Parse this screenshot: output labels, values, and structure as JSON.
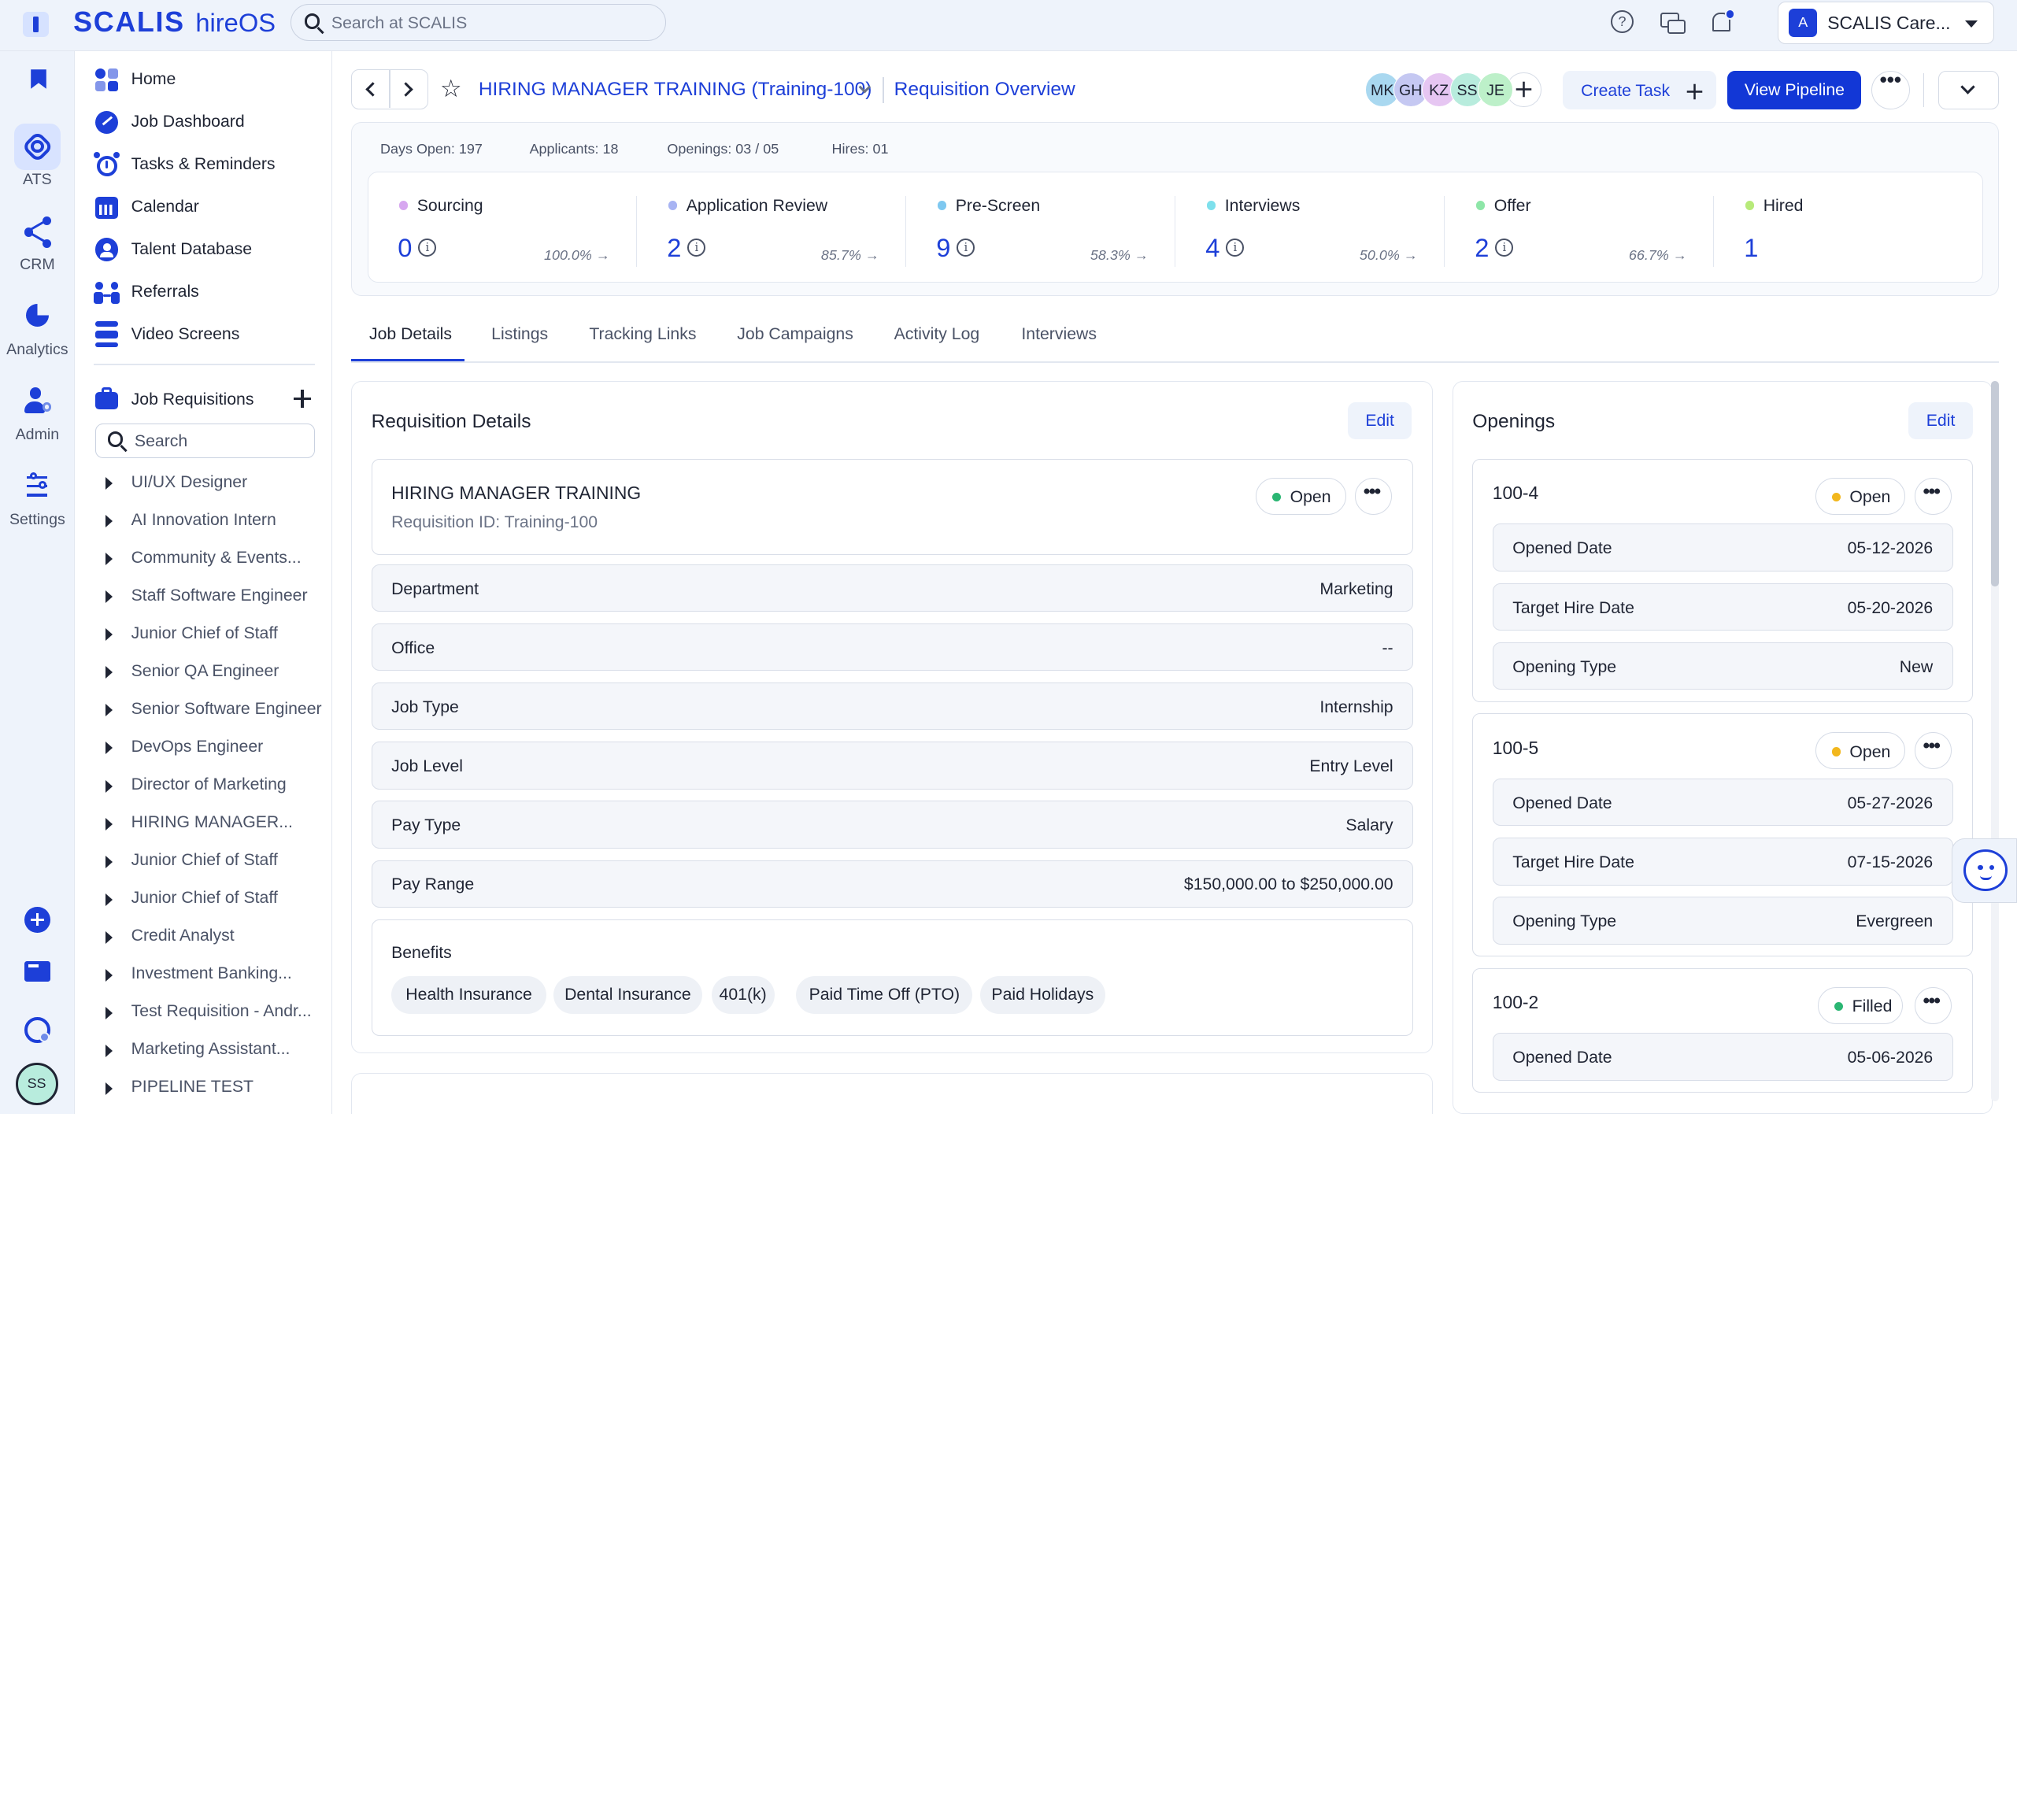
{
  "app": {
    "logo": "SCALIS",
    "product": "hireOS"
  },
  "topbar": {
    "search_placeholder": "Search at SCALIS",
    "org_name": "SCALIS Care...",
    "org_initial": "A"
  },
  "rail": {
    "items": [
      {
        "label": "",
        "icon": "bookmark-icon"
      },
      {
        "label": "ATS",
        "icon": "ats-icon"
      },
      {
        "label": "CRM",
        "icon": "crm-icon"
      },
      {
        "label": "Analytics",
        "icon": "analytics-icon"
      },
      {
        "label": "Admin",
        "icon": "admin-icon"
      },
      {
        "label": "Settings",
        "icon": "settings-icon"
      }
    ],
    "user_initials": "SS"
  },
  "sidebar": {
    "nav": [
      {
        "label": "Home"
      },
      {
        "label": "Job Dashboard"
      },
      {
        "label": "Tasks & Reminders"
      },
      {
        "label": "Calendar"
      },
      {
        "label": "Talent Database"
      },
      {
        "label": "Referrals"
      },
      {
        "label": "Video Screens"
      }
    ],
    "requisitions_label": "Job Requisitions",
    "search_placeholder": "Search",
    "requisitions": [
      "UI/UX Designer",
      "AI Innovation Intern",
      "Community & Events...",
      "Staff Software Engineer",
      "Junior Chief of Staff",
      "Senior QA Engineer",
      "Senior Software Engineer",
      "DevOps Engineer",
      "Director of Marketing",
      "HIRING MANAGER...",
      "Junior Chief of Staff",
      "Junior Chief of Staff",
      "Credit Analyst",
      "Investment Banking...",
      "Test Requisition - Andr...",
      "Marketing Assistant...",
      "PIPELINE TEST"
    ]
  },
  "header": {
    "title": "HIRING MANAGER TRAINING (Training-100)",
    "subtitle": "Requisition Overview",
    "avatars": [
      {
        "initials": "MK",
        "color": "#a9d8f0"
      },
      {
        "initials": "GH",
        "color": "#c5c8f2"
      },
      {
        "initials": "KZ",
        "color": "#e6c6f2"
      },
      {
        "initials": "SS",
        "color": "#b8ecdd"
      },
      {
        "initials": "JE",
        "color": "#bdf0c9"
      }
    ],
    "create_task": "Create Task",
    "view_pipeline": "View Pipeline"
  },
  "stats": {
    "days_open": "Days Open: 197",
    "applicants": "Applicants: 18",
    "openings": "Openings: 03 / 05",
    "hires": "Hires: 01"
  },
  "stages": [
    {
      "name": "Sourcing",
      "count": "0",
      "pct": "100.0% →",
      "color": "#d7a7f0"
    },
    {
      "name": "Application Review",
      "count": "2",
      "pct": "85.7% →",
      "color": "#a8b4f3"
    },
    {
      "name": "Pre-Screen",
      "count": "9",
      "pct": "58.3% →",
      "color": "#7ec8f0"
    },
    {
      "name": "Interviews",
      "count": "4",
      "pct": "50.0% →",
      "color": "#7ee0ec"
    },
    {
      "name": "Offer",
      "count": "2",
      "pct": "66.7% →",
      "color": "#8ee6a8"
    },
    {
      "name": "Hired",
      "count": "1",
      "pct": "",
      "color": "#b7ea7a"
    }
  ],
  "tabs": [
    "Job Details",
    "Listings",
    "Tracking Links",
    "Job Campaigns",
    "Activity Log",
    "Interviews"
  ],
  "requisition": {
    "title": "Requisition Details",
    "edit": "Edit",
    "name": "HIRING MANAGER TRAINING",
    "req_id": "Requisition ID: Training-100",
    "status": "Open",
    "fields": [
      {
        "key": "Department",
        "value": "Marketing"
      },
      {
        "key": "Office",
        "value": "--"
      },
      {
        "key": "Job Type",
        "value": "Internship"
      },
      {
        "key": "Job Level",
        "value": "Entry Level"
      },
      {
        "key": "Pay Type",
        "value": "Salary"
      },
      {
        "key": "Pay Range",
        "value": "$150,000.00 to $250,000.00"
      }
    ],
    "benefits_label": "Benefits",
    "benefits": [
      "Health Insurance",
      "Dental Insurance",
      "401(k)",
      "Paid Time Off (PTO)",
      "Paid Holidays"
    ]
  },
  "openings": {
    "title": "Openings",
    "edit": "Edit",
    "items": [
      {
        "id": "100-4",
        "status": "Open",
        "status_color": "#f2b71d",
        "rows": [
          {
            "key": "Opened Date",
            "value": "05-12-2026"
          },
          {
            "key": "Target Hire Date",
            "value": "05-20-2026"
          },
          {
            "key": "Opening Type",
            "value": "New"
          }
        ]
      },
      {
        "id": "100-5",
        "status": "Open",
        "status_color": "#f2b71d",
        "rows": [
          {
            "key": "Opened Date",
            "value": "05-27-2026"
          },
          {
            "key": "Target Hire Date",
            "value": "07-15-2026"
          },
          {
            "key": "Opening Type",
            "value": "Evergreen"
          }
        ]
      },
      {
        "id": "100-2",
        "status": "Filled",
        "status_color": "#2bb673",
        "rows": [
          {
            "key": "Opened Date",
            "value": "05-06-2026"
          }
        ]
      }
    ]
  }
}
